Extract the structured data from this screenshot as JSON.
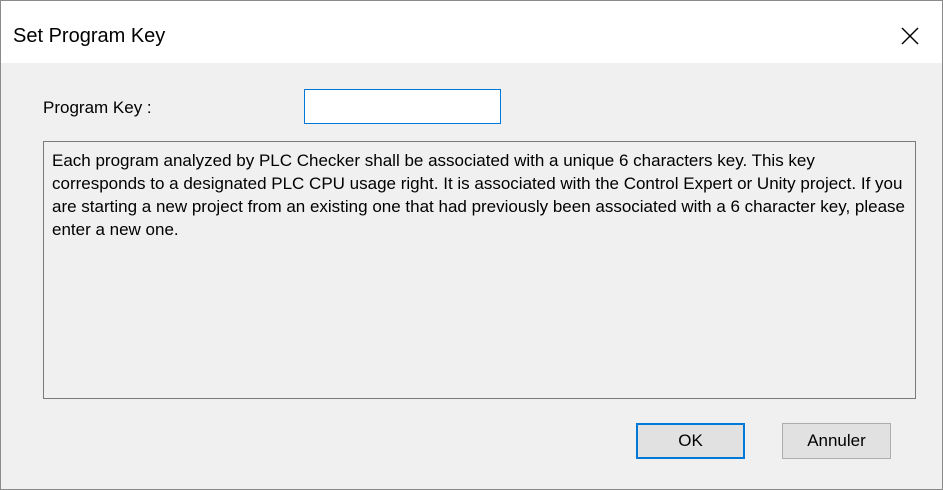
{
  "window": {
    "title": "Set Program Key"
  },
  "form": {
    "program_key_label": "Program Key :",
    "program_key_value": ""
  },
  "description": {
    "text": "Each program analyzed by PLC Checker shall be associated with a unique 6 characters key. This key corresponds to a designated PLC CPU usage right. It is associated with the Control Expert or Unity project. If you are starting a new project from an existing one that had previously been associated with a 6 character key, please enter a new one."
  },
  "buttons": {
    "ok_label": "OK",
    "cancel_label": "Annuler"
  },
  "icons": {
    "close": "close-icon"
  },
  "colors": {
    "accent": "#0078d7",
    "dialog_background": "#f0f0f0",
    "titlebar_background": "#ffffff"
  }
}
